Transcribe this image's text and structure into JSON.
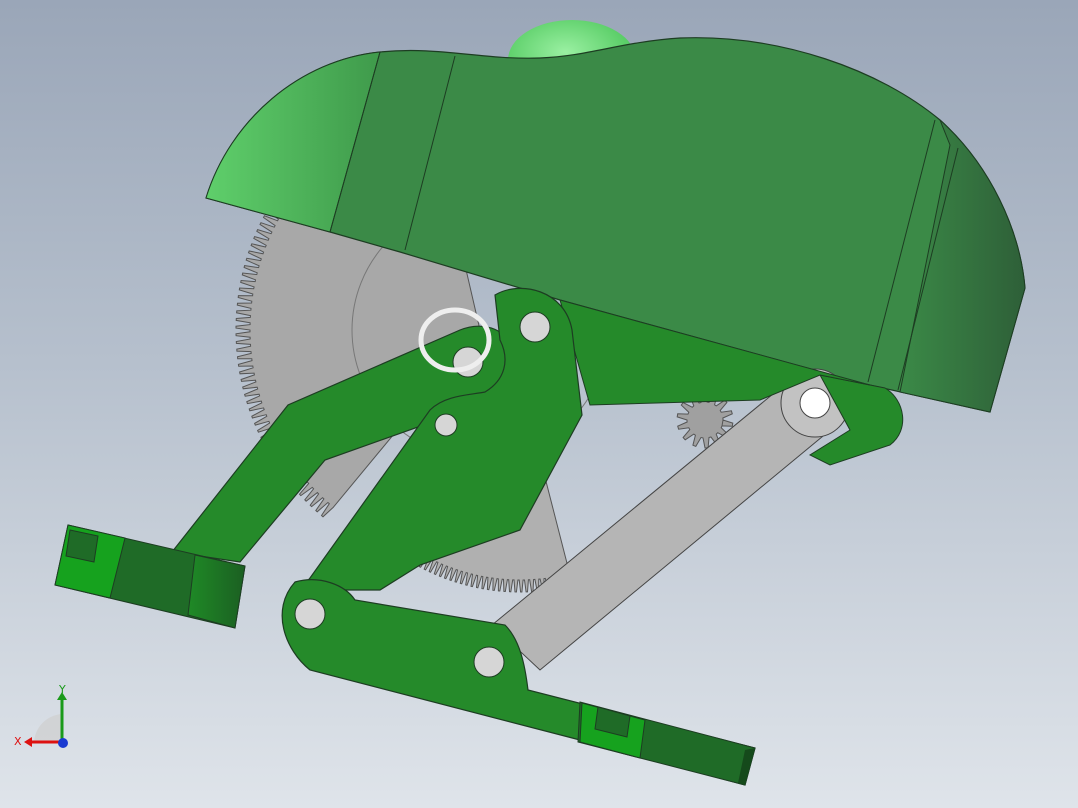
{
  "viewport": {
    "description_free": true
  },
  "colors": {
    "background_top": "#9aa6b8",
    "background_bottom": "#dfe4ea",
    "housing_green": "#3b8a47",
    "housing_light": "#55b860",
    "housing_dark": "#2f6b3a",
    "link_green": "#258a2a",
    "gear_gray": "#a9a9a9",
    "bar_gray": "#b4b4b4",
    "axis_x": "#d11",
    "axis_y": "#1a9a1a",
    "axis_z": "#1a3ad1"
  },
  "triad": {
    "x_label": "X",
    "y_label": "Y"
  }
}
